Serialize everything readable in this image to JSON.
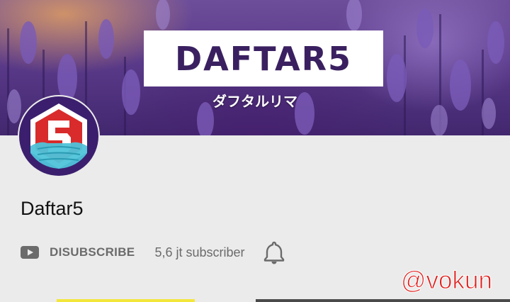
{
  "banner": {
    "logo_text": "DAFTAR5",
    "logo_subtitle": "ダフタルリマ"
  },
  "avatar": {
    "logo_letter": "5"
  },
  "channel": {
    "name": "Daftar5",
    "subscribe_label": "DISUBSCRIBE",
    "subscriber_count": "5,6 jt subscriber"
  },
  "watermark": "@vokun",
  "icons": {
    "subscribe": "youtube-play-icon",
    "notifications": "bell-icon"
  },
  "colors": {
    "background": "#ebebeb",
    "banner_purple": "#5a3a8a",
    "logo_text": "#3a2060",
    "watermark": "#e0211f",
    "avatar_red": "#d92b2b",
    "mask_teal": "#4fc3d9"
  }
}
